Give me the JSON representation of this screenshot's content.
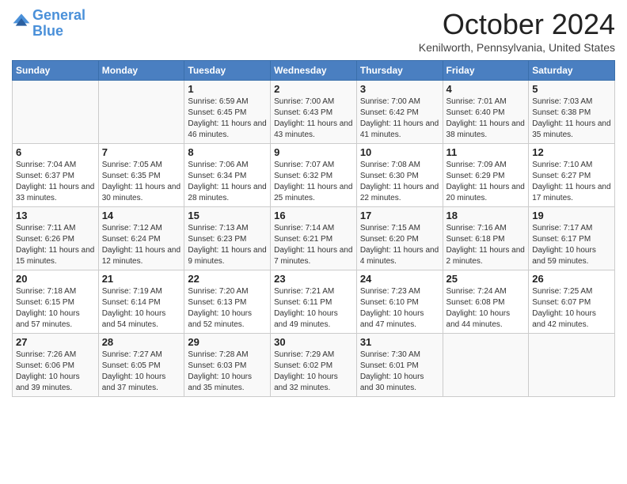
{
  "logo": {
    "line1": "General",
    "line2": "Blue"
  },
  "title": "October 2024",
  "subtitle": "Kenilworth, Pennsylvania, United States",
  "days_of_week": [
    "Sunday",
    "Monday",
    "Tuesday",
    "Wednesday",
    "Thursday",
    "Friday",
    "Saturday"
  ],
  "weeks": [
    [
      {
        "day": "",
        "info": ""
      },
      {
        "day": "",
        "info": ""
      },
      {
        "day": "1",
        "info": "Sunrise: 6:59 AM\nSunset: 6:45 PM\nDaylight: 11 hours and 46 minutes."
      },
      {
        "day": "2",
        "info": "Sunrise: 7:00 AM\nSunset: 6:43 PM\nDaylight: 11 hours and 43 minutes."
      },
      {
        "day": "3",
        "info": "Sunrise: 7:00 AM\nSunset: 6:42 PM\nDaylight: 11 hours and 41 minutes."
      },
      {
        "day": "4",
        "info": "Sunrise: 7:01 AM\nSunset: 6:40 PM\nDaylight: 11 hours and 38 minutes."
      },
      {
        "day": "5",
        "info": "Sunrise: 7:03 AM\nSunset: 6:38 PM\nDaylight: 11 hours and 35 minutes."
      }
    ],
    [
      {
        "day": "6",
        "info": "Sunrise: 7:04 AM\nSunset: 6:37 PM\nDaylight: 11 hours and 33 minutes."
      },
      {
        "day": "7",
        "info": "Sunrise: 7:05 AM\nSunset: 6:35 PM\nDaylight: 11 hours and 30 minutes."
      },
      {
        "day": "8",
        "info": "Sunrise: 7:06 AM\nSunset: 6:34 PM\nDaylight: 11 hours and 28 minutes."
      },
      {
        "day": "9",
        "info": "Sunrise: 7:07 AM\nSunset: 6:32 PM\nDaylight: 11 hours and 25 minutes."
      },
      {
        "day": "10",
        "info": "Sunrise: 7:08 AM\nSunset: 6:30 PM\nDaylight: 11 hours and 22 minutes."
      },
      {
        "day": "11",
        "info": "Sunrise: 7:09 AM\nSunset: 6:29 PM\nDaylight: 11 hours and 20 minutes."
      },
      {
        "day": "12",
        "info": "Sunrise: 7:10 AM\nSunset: 6:27 PM\nDaylight: 11 hours and 17 minutes."
      }
    ],
    [
      {
        "day": "13",
        "info": "Sunrise: 7:11 AM\nSunset: 6:26 PM\nDaylight: 11 hours and 15 minutes."
      },
      {
        "day": "14",
        "info": "Sunrise: 7:12 AM\nSunset: 6:24 PM\nDaylight: 11 hours and 12 minutes."
      },
      {
        "day": "15",
        "info": "Sunrise: 7:13 AM\nSunset: 6:23 PM\nDaylight: 11 hours and 9 minutes."
      },
      {
        "day": "16",
        "info": "Sunrise: 7:14 AM\nSunset: 6:21 PM\nDaylight: 11 hours and 7 minutes."
      },
      {
        "day": "17",
        "info": "Sunrise: 7:15 AM\nSunset: 6:20 PM\nDaylight: 11 hours and 4 minutes."
      },
      {
        "day": "18",
        "info": "Sunrise: 7:16 AM\nSunset: 6:18 PM\nDaylight: 11 hours and 2 minutes."
      },
      {
        "day": "19",
        "info": "Sunrise: 7:17 AM\nSunset: 6:17 PM\nDaylight: 10 hours and 59 minutes."
      }
    ],
    [
      {
        "day": "20",
        "info": "Sunrise: 7:18 AM\nSunset: 6:15 PM\nDaylight: 10 hours and 57 minutes."
      },
      {
        "day": "21",
        "info": "Sunrise: 7:19 AM\nSunset: 6:14 PM\nDaylight: 10 hours and 54 minutes."
      },
      {
        "day": "22",
        "info": "Sunrise: 7:20 AM\nSunset: 6:13 PM\nDaylight: 10 hours and 52 minutes."
      },
      {
        "day": "23",
        "info": "Sunrise: 7:21 AM\nSunset: 6:11 PM\nDaylight: 10 hours and 49 minutes."
      },
      {
        "day": "24",
        "info": "Sunrise: 7:23 AM\nSunset: 6:10 PM\nDaylight: 10 hours and 47 minutes."
      },
      {
        "day": "25",
        "info": "Sunrise: 7:24 AM\nSunset: 6:08 PM\nDaylight: 10 hours and 44 minutes."
      },
      {
        "day": "26",
        "info": "Sunrise: 7:25 AM\nSunset: 6:07 PM\nDaylight: 10 hours and 42 minutes."
      }
    ],
    [
      {
        "day": "27",
        "info": "Sunrise: 7:26 AM\nSunset: 6:06 PM\nDaylight: 10 hours and 39 minutes."
      },
      {
        "day": "28",
        "info": "Sunrise: 7:27 AM\nSunset: 6:05 PM\nDaylight: 10 hours and 37 minutes."
      },
      {
        "day": "29",
        "info": "Sunrise: 7:28 AM\nSunset: 6:03 PM\nDaylight: 10 hours and 35 minutes."
      },
      {
        "day": "30",
        "info": "Sunrise: 7:29 AM\nSunset: 6:02 PM\nDaylight: 10 hours and 32 minutes."
      },
      {
        "day": "31",
        "info": "Sunrise: 7:30 AM\nSunset: 6:01 PM\nDaylight: 10 hours and 30 minutes."
      },
      {
        "day": "",
        "info": ""
      },
      {
        "day": "",
        "info": ""
      }
    ]
  ]
}
